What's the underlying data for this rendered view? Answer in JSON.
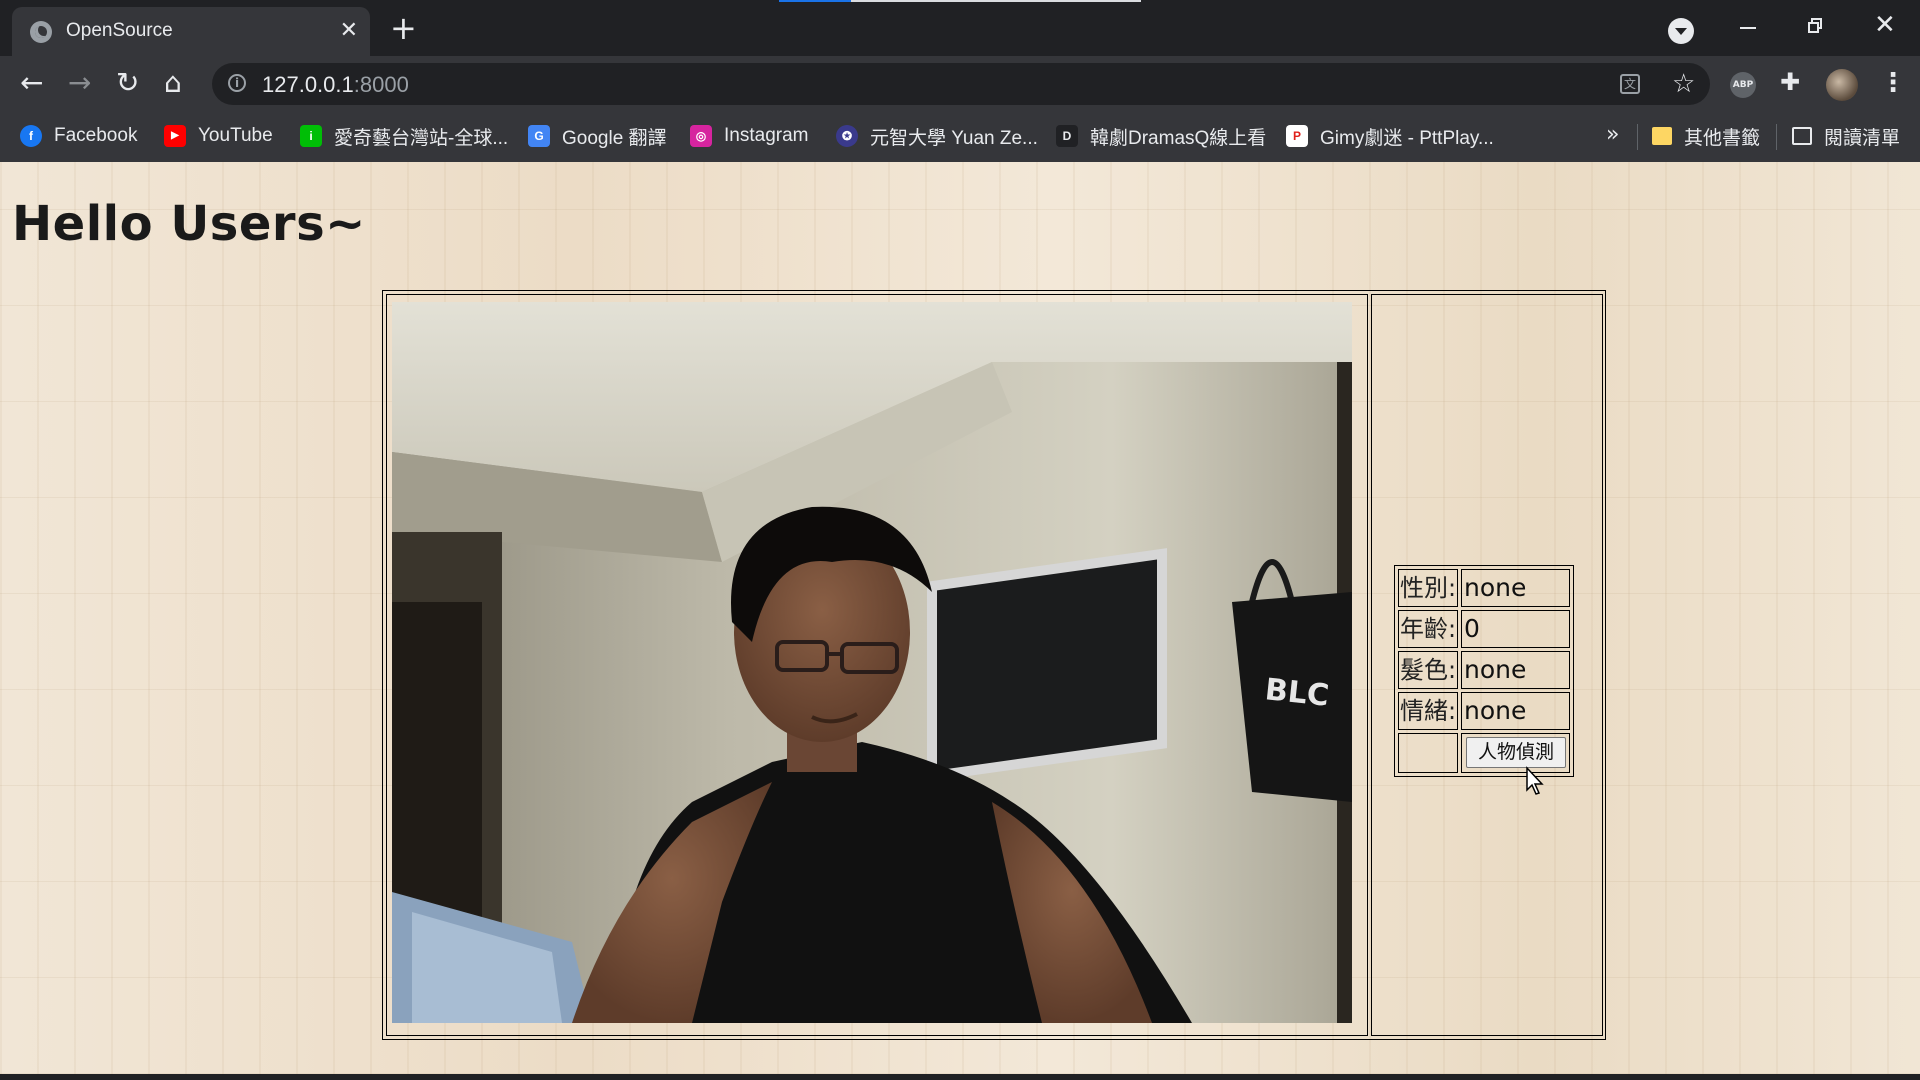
{
  "tab": {
    "title": "OpenSource",
    "close": "✕"
  },
  "new_tab": "+",
  "window": {
    "minimize": "",
    "close": "✕"
  },
  "toolbar": {
    "back": "←",
    "forward": "→",
    "reload": "↻",
    "home": "⌂",
    "url_host": "127.0.0.1",
    "url_port": ":8000",
    "star": "☆",
    "abp": "ABP",
    "menu": "⋮"
  },
  "bookmarks": {
    "items": [
      {
        "label": "Facebook",
        "icon": "facebook-icon",
        "color": "#1877f2",
        "glyph": "f"
      },
      {
        "label": "YouTube",
        "icon": "youtube-icon",
        "color": "#ff0000",
        "glyph": "▶"
      },
      {
        "label": "愛奇藝台灣站-全球...",
        "icon": "iqiyi-icon",
        "color": "#00be06",
        "glyph": "i"
      },
      {
        "label": "Google 翻譯",
        "icon": "google-translate-icon",
        "color": "#4285f4",
        "glyph": "G"
      },
      {
        "label": "Instagram",
        "icon": "instagram-icon",
        "color": "#d6249f",
        "glyph": "◎"
      },
      {
        "label": "元智大學 Yuan Ze...",
        "icon": "yzu-icon",
        "color": "#3a3a8c",
        "glyph": "✪"
      },
      {
        "label": "韓劇DramasQ線上看",
        "icon": "dramasq-icon",
        "color": "#202124",
        "glyph": "D"
      },
      {
        "label": "Gimy劇迷 - PttPlay...",
        "icon": "gimy-icon",
        "color": "#ffffff",
        "glyph": "P"
      }
    ],
    "more": "»",
    "other_bookmarks": "其他書籤",
    "reading_list": "閱讀清單"
  },
  "page": {
    "heading": "Hello Users~",
    "info": {
      "rows": [
        {
          "label": "性別:",
          "value": "none"
        },
        {
          "label": "年齡:",
          "value": "0"
        },
        {
          "label": "髮色:",
          "value": "none"
        },
        {
          "label": "情緒:",
          "value": "none"
        }
      ],
      "button": "人物偵測"
    }
  }
}
